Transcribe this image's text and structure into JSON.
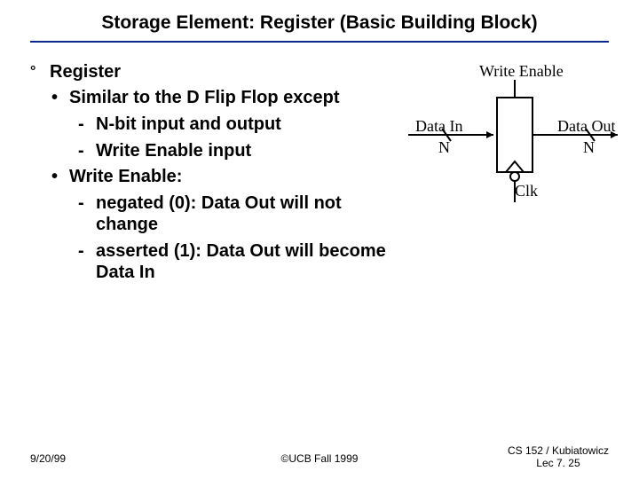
{
  "title": "Storage Element: Register (Basic Building Block)",
  "bullets": {
    "register": "Register",
    "similar": "Similar to the D Flip Flop except",
    "nbit": "N-bit input and output",
    "weinput": "Write Enable input",
    "welabel": "Write Enable:",
    "negated": "negated  (0): Data Out will not change",
    "asserted": "asserted (1): Data Out will become Data In"
  },
  "diagram": {
    "write_enable": "Write Enable",
    "data_in": "Data In",
    "data_out": "Data Out",
    "n_left": "N",
    "n_right": "N",
    "clk": "Clk"
  },
  "footer": {
    "date": "9/20/99",
    "center": "©UCB Fall 1999",
    "right_line1": "CS 152 / Kubiatowicz",
    "right_line2": "Lec 7. 25"
  }
}
